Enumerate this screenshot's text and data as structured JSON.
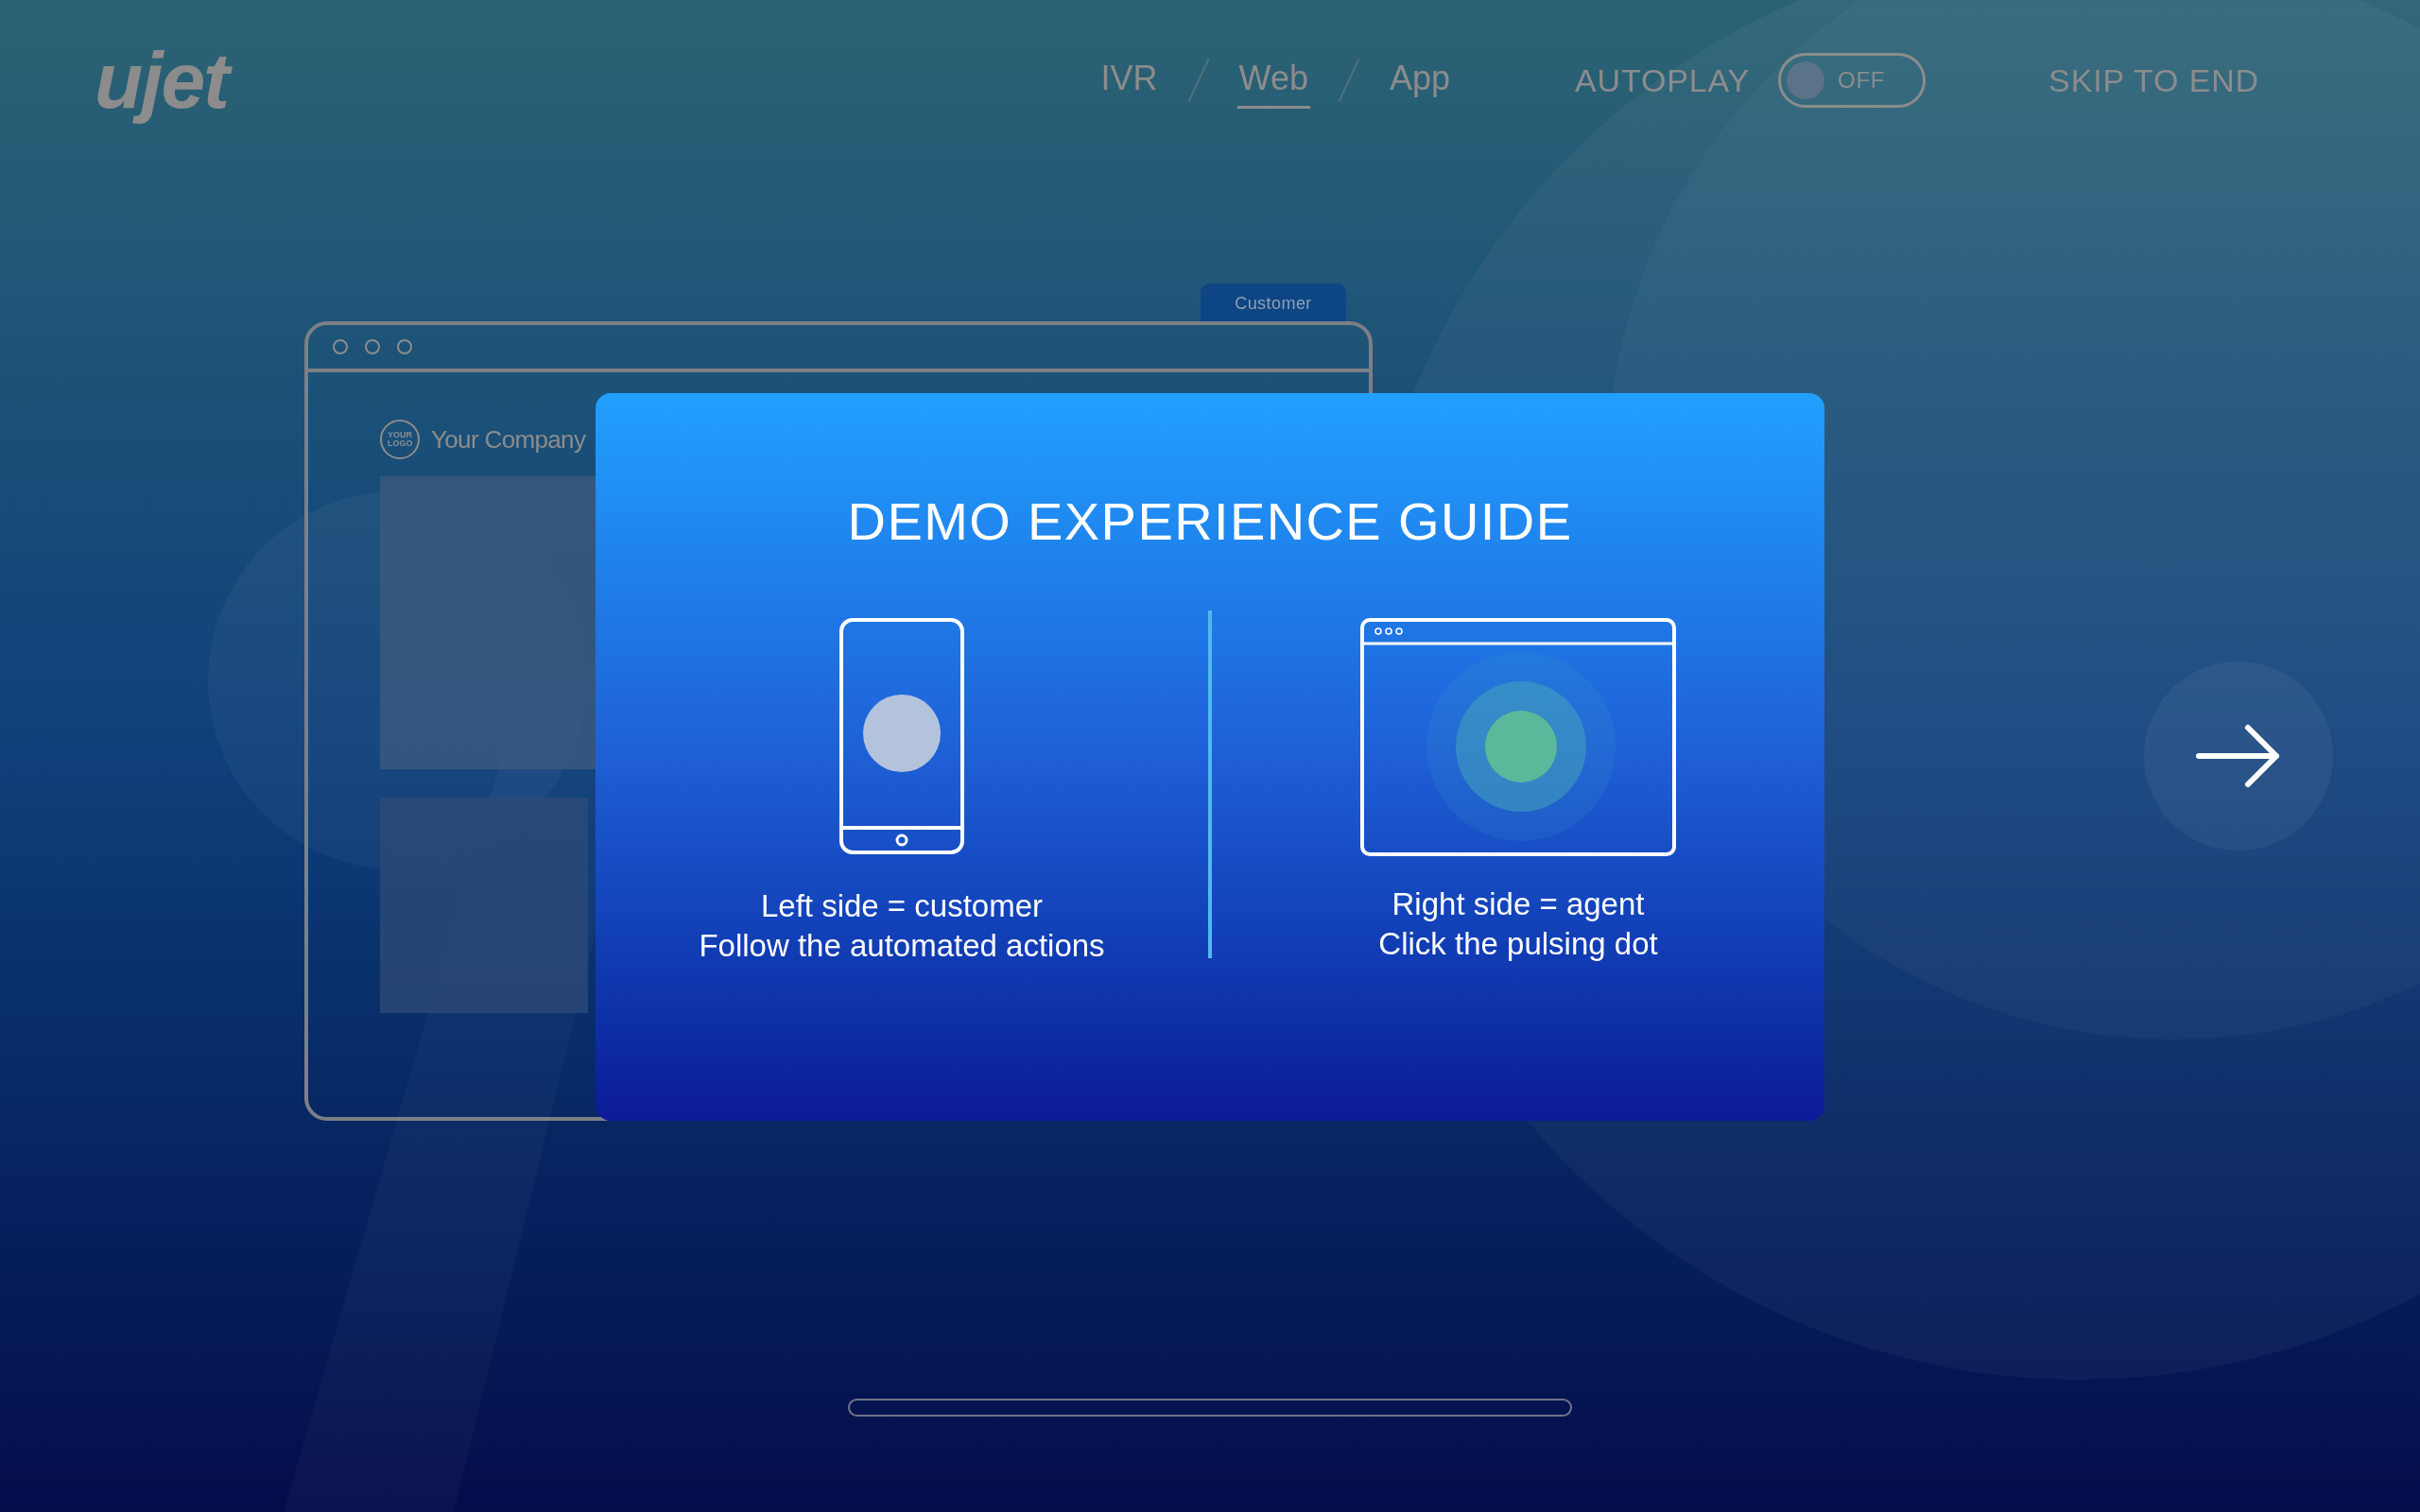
{
  "logo": {
    "text": "ujet"
  },
  "nav": {
    "tabs": [
      {
        "label": "IVR",
        "selected": false
      },
      {
        "label": "Web",
        "selected": true
      },
      {
        "label": "App",
        "selected": false
      }
    ],
    "autoplay": {
      "label": "AUTOPLAY",
      "on": false,
      "state_label": "OFF"
    },
    "skip": "SKIP TO END"
  },
  "customer_window": {
    "tab": "Customer",
    "logo_badge": "YOUR LOGO",
    "company": "Your Company"
  },
  "guide": {
    "title": "DEMO EXPERIENCE GUIDE",
    "left": {
      "line1": "Left side = customer",
      "line2": "Follow the automated actions"
    },
    "right": {
      "line1": "Right side = agent",
      "line2": "Click the pulsing dot"
    }
  },
  "progress": {
    "level": 0
  }
}
